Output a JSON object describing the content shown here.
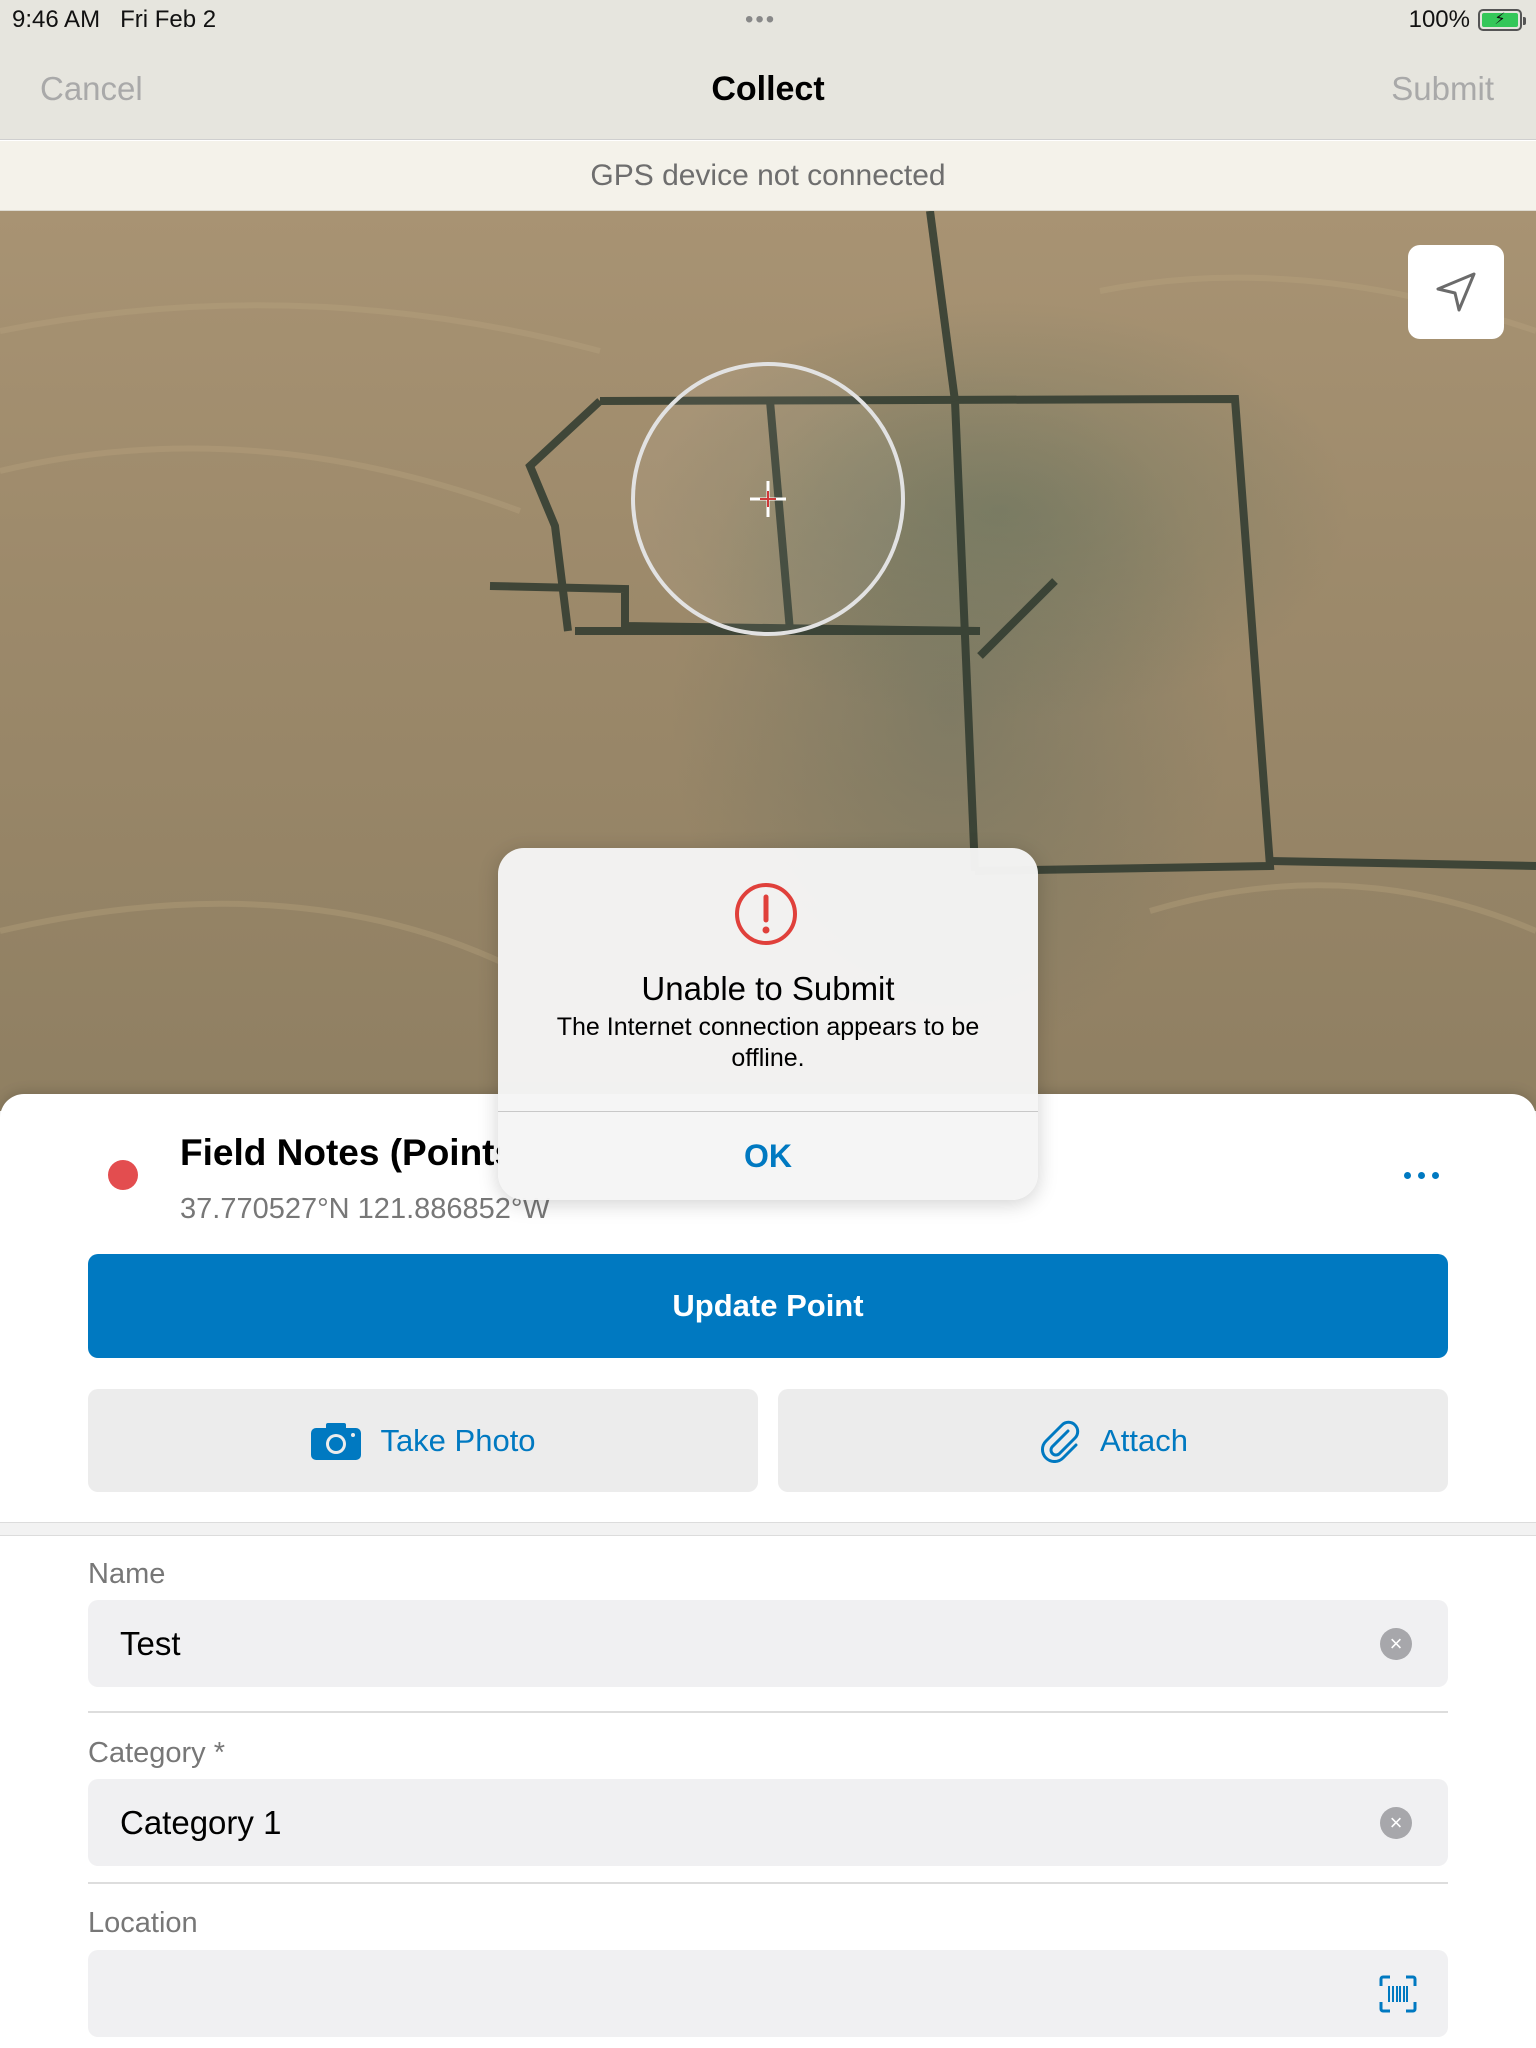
{
  "status_bar": {
    "time": "9:46 AM",
    "date": "Fri Feb 2",
    "more_dots": "•••",
    "battery": "100%"
  },
  "nav": {
    "cancel": "Cancel",
    "title": "Collect",
    "submit": "Submit"
  },
  "gps_banner": "GPS device not connected",
  "map": {
    "locate_icon": "navigation-arrow-icon",
    "crosshair_icon": "crosshair-icon"
  },
  "feature": {
    "title": "Field Notes (Points)",
    "coordinates": "37.770527°N  121.886852°W",
    "dot_color": "#e34d4f",
    "more_icon": "ellipsis-icon"
  },
  "buttons": {
    "update_point": "Update Point",
    "take_photo": "Take Photo",
    "attach": "Attach"
  },
  "form": {
    "name_label": "Name",
    "name_value": "Test",
    "category_label": "Category *",
    "category_value": "Category 1",
    "location_label": "Location",
    "location_value": ""
  },
  "alert": {
    "title": "Unable to Submit",
    "message": "The Internet connection appears to be offline.",
    "ok": "OK",
    "icon": "warning-icon",
    "icon_color": "#e0403b"
  },
  "colors": {
    "accent": "#0079c1",
    "disabled_text": "#a9a9a9"
  }
}
